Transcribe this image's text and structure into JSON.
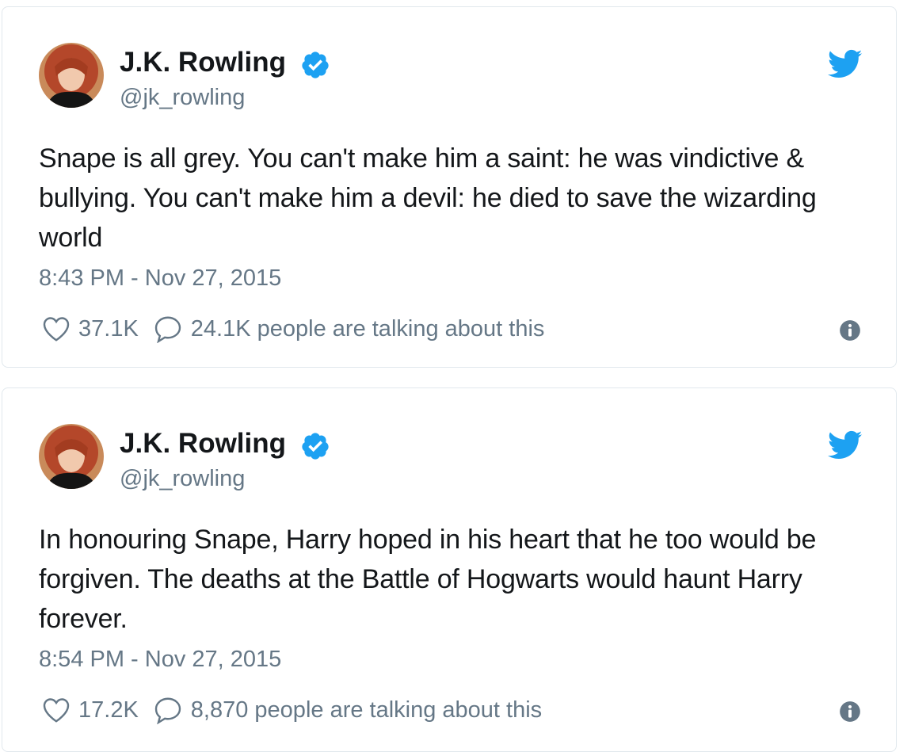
{
  "colors": {
    "verified_badge": "#1da1f2",
    "twitter_bird": "#1da1f2",
    "secondary_text": "#657786",
    "primary_text": "#14171a",
    "card_border": "#e1e8ed"
  },
  "icons": {
    "verified": "verified-badge-icon",
    "brand": "twitter-bird-icon",
    "like": "heart-icon",
    "reply": "speech-bubble-icon",
    "info": "info-icon"
  },
  "tweets": [
    {
      "author_name": "J.K. Rowling",
      "author_handle": "@jk_rowling",
      "text": "Snape is all grey. You can't make him a saint: he was vindictive & bullying. You can't make him a devil: he died to save the wizarding world",
      "timestamp": "8:43 PM - Nov 27, 2015",
      "likes": "37.1K",
      "talking": "24.1K people are talking about this"
    },
    {
      "author_name": "J.K. Rowling",
      "author_handle": "@jk_rowling",
      "text": "In honouring Snape, Harry hoped in his heart that he too would be forgiven. The deaths at the Battle of Hogwarts would haunt Harry forever.",
      "timestamp": "8:54 PM - Nov 27, 2015",
      "likes": "17.2K",
      "talking": "8,870 people are talking about this"
    }
  ]
}
